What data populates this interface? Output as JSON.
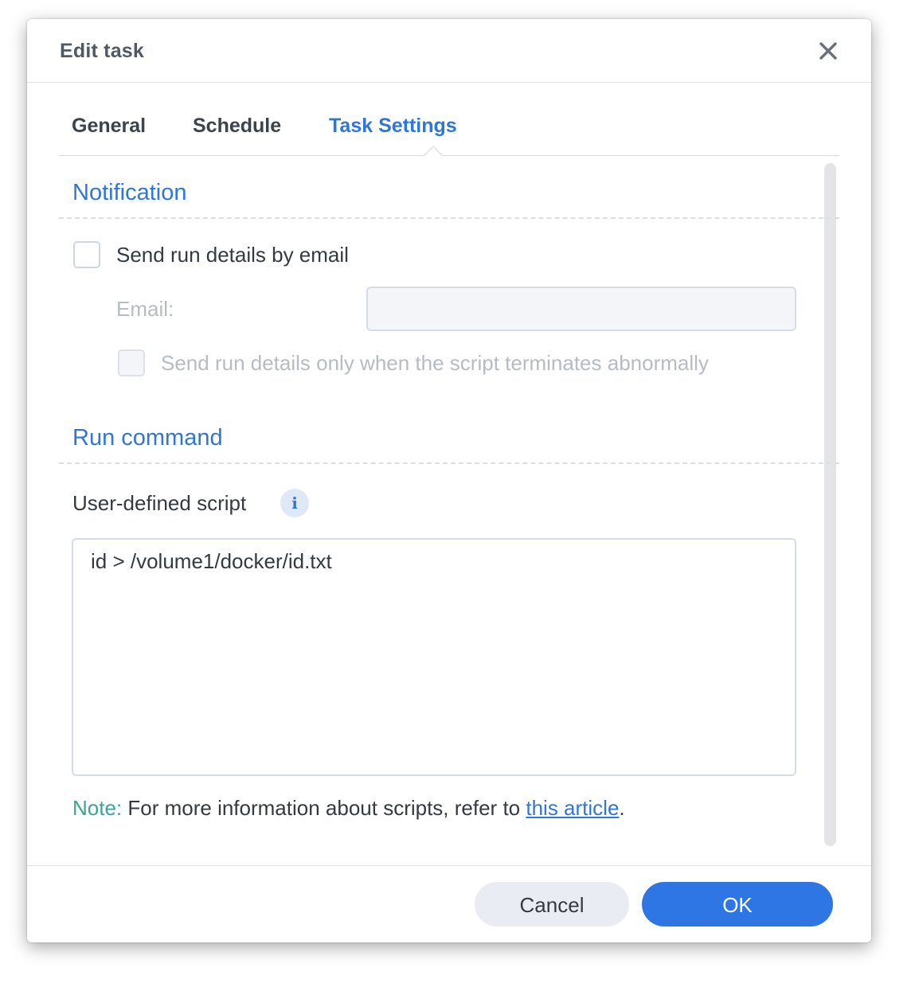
{
  "dialog": {
    "title": "Edit task"
  },
  "tabs": [
    {
      "label": "General"
    },
    {
      "label": "Schedule"
    },
    {
      "label": "Task Settings"
    }
  ],
  "active_tab": "Task Settings",
  "notification": {
    "section_title": "Notification",
    "send_email_label": "Send run details by email",
    "send_email_checked": false,
    "email_label": "Email:",
    "email_value": "",
    "abnormal_only_label": "Send run details only when the script terminates abnormally",
    "abnormal_only_checked": false
  },
  "run_command": {
    "section_title": "Run command",
    "script_label": "User-defined script",
    "script_value": "id > /volume1/docker/id.txt",
    "note_prefix": "Note:",
    "note_text": " For more information about scripts, refer to ",
    "note_link": "this article",
    "note_suffix": "."
  },
  "footer": {
    "cancel_label": "Cancel",
    "ok_label": "OK"
  },
  "colors": {
    "accent": "#2f76d9",
    "ok_button": "#2f76e5",
    "note_prefix": "#3aa39a"
  },
  "icons": {
    "close": "close-icon",
    "info": "info-icon",
    "tab_pointer": "tab-pointer-icon"
  }
}
